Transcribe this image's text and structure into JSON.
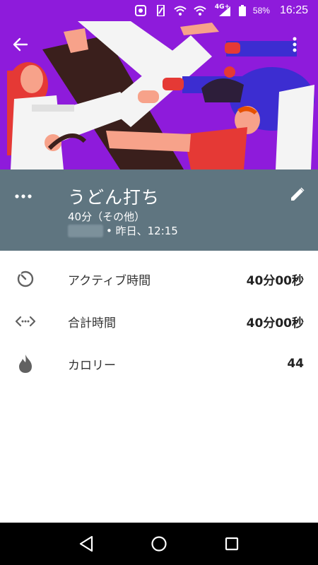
{
  "status_bar": {
    "network_type": "4G+",
    "battery_percent": "58%",
    "time": "16:25"
  },
  "activity": {
    "title": "うどん打ち",
    "summary": "40分（その他）",
    "when": "• 昨日、12:15"
  },
  "stats": [
    {
      "icon": "timer-icon",
      "label": "アクティブ時間",
      "value": "40分00秒"
    },
    {
      "icon": "duration-arrows-icon",
      "label": "合計時間",
      "value": "40分00秒"
    },
    {
      "icon": "flame-icon",
      "label": "カロリー",
      "value": "44"
    }
  ],
  "colors": {
    "hero_background": "#8E1BDB",
    "title_band": "#5F7580",
    "nav_bar": "#000000"
  }
}
